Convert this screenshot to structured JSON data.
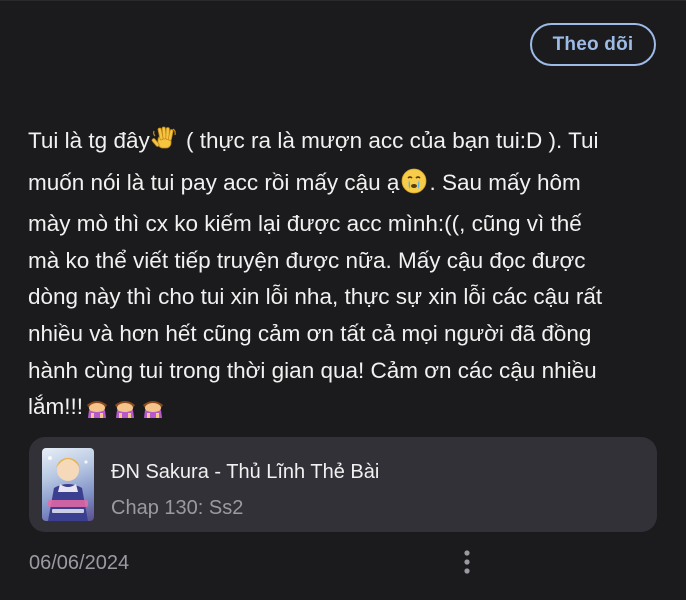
{
  "header": {
    "follow_label": "Theo dõi"
  },
  "post": {
    "line1_a": "Tui là tg đây",
    "line1_b": " ( thực ra là mượn acc của bạn tui:D ). Tui",
    "line2_a": "muốn nói là tui pay acc rồi mấy cậu ạ",
    "line2_b": ". Sau mấy hôm",
    "line3": "mày mò thì cx ko kiếm lại được acc mình:((, cũng vì thế",
    "line4": "mà ko thể viết tiếp truyện được nữa. Mấy cậu đọc được",
    "line5": "dòng này thì cho tui xin lỗi nha, thực sự xin lỗi các cậu rất",
    "line6": "nhiều và hơn hết cũng cảm ơn tất cả mọi người đã đồng",
    "line7": "hành cùng tui trong thời gian qua! Cảm ơn các cậu nhiều",
    "line8": "lắm!!!",
    "emojis": [
      "waving-hand",
      "crying-face",
      "bowing-person",
      "bowing-person",
      "bowing-person"
    ]
  },
  "story": {
    "title": "ĐN Sakura - Thủ Lĩnh Thẻ Bài",
    "chapter": "Chap 130: Ss2"
  },
  "footer": {
    "date": "06/06/2024"
  },
  "colors": {
    "background": "#1b1b1d",
    "accent": "#9dbbe6",
    "card": "#313137",
    "muted": "#9a9aa1"
  }
}
